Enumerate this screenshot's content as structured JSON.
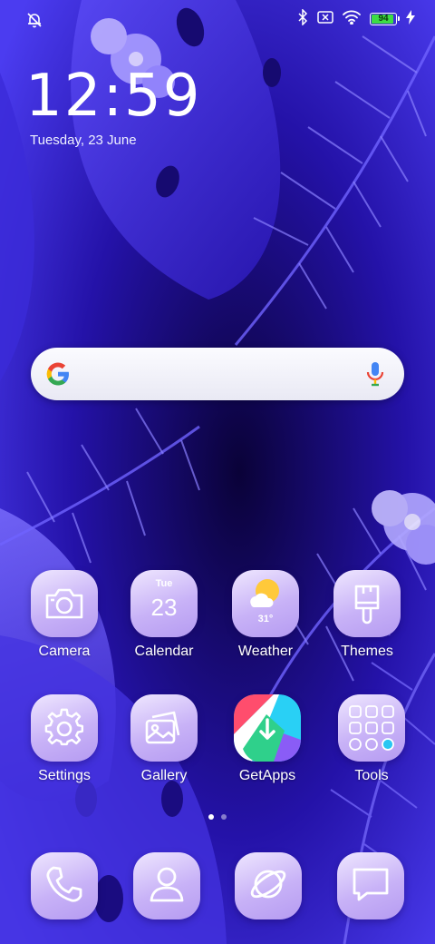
{
  "status_bar": {
    "battery_level": "94",
    "icons": [
      "alarm-off-icon",
      "bluetooth-icon",
      "sim-none-icon",
      "wifi-icon",
      "battery-icon",
      "charging-icon"
    ]
  },
  "clock": {
    "time": "12:59",
    "date": "Tuesday, 23 June"
  },
  "search": {
    "icons": [
      "google-logo-icon",
      "microphone-icon"
    ]
  },
  "apps": [
    {
      "label": "Camera",
      "icon": "camera-icon"
    },
    {
      "label": "Calendar",
      "icon": "calendar-icon",
      "day": "Tue",
      "date": "23"
    },
    {
      "label": "Weather",
      "icon": "weather-icon",
      "temp": "31°"
    },
    {
      "label": "Themes",
      "icon": "paintbrush-icon"
    },
    {
      "label": "Settings",
      "icon": "gear-icon"
    },
    {
      "label": "Gallery",
      "icon": "gallery-icon"
    },
    {
      "label": "GetApps",
      "icon": "getapps-icon"
    },
    {
      "label": "Tools",
      "icon": "tools-folder-icon"
    }
  ],
  "page_indicator": {
    "pages": 2,
    "active": 1
  },
  "dock": [
    {
      "icon": "phone-icon"
    },
    {
      "icon": "contacts-icon"
    },
    {
      "icon": "browser-icon"
    },
    {
      "icon": "messages-icon"
    }
  ],
  "colors": {
    "wallpaper": "#2b16c9",
    "icon_bg": "#c8b2f7",
    "battery": "#3ddc45"
  }
}
